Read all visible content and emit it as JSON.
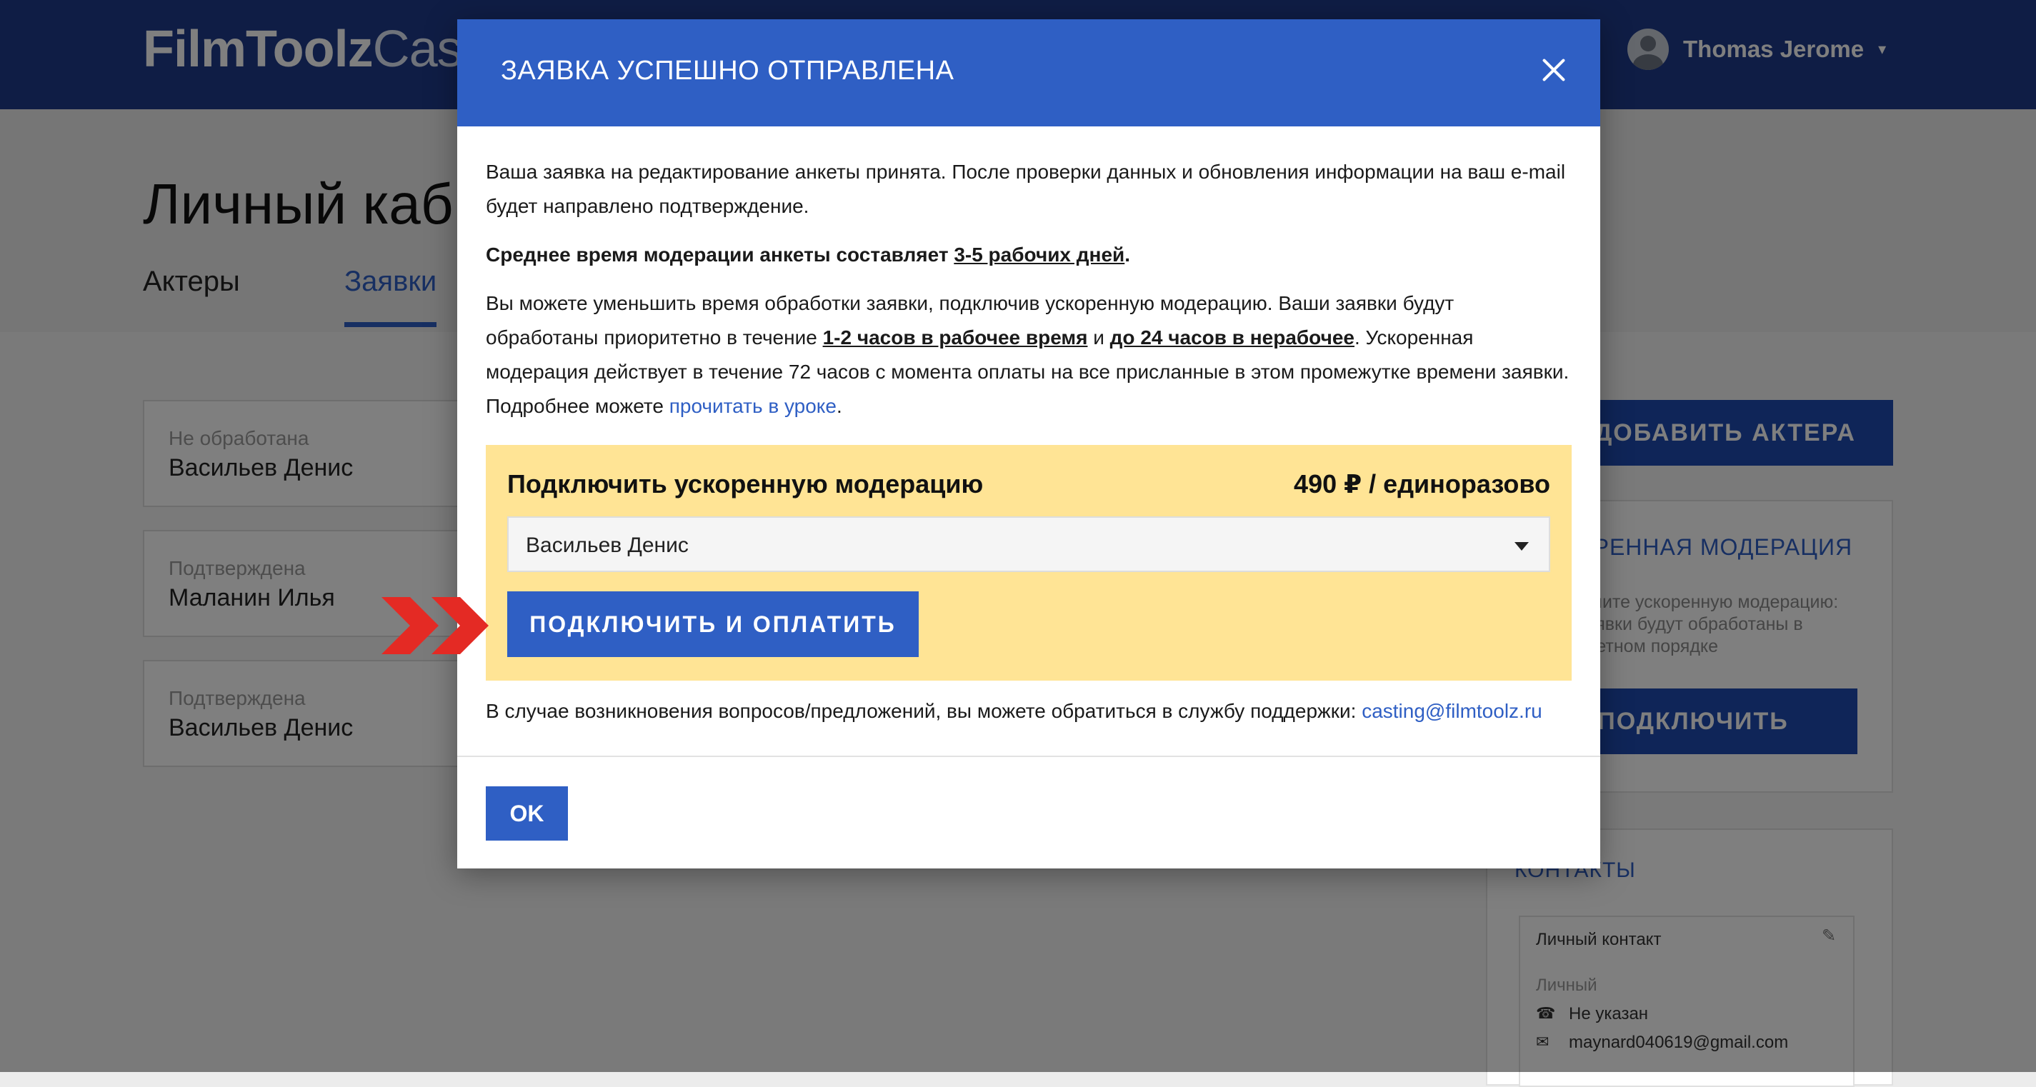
{
  "app": {
    "logo_bold": "FilmToolz",
    "logo_light": "Casting",
    "user_name": "Thomas Jerome",
    "caret": "▾"
  },
  "page": {
    "title": "Личный кабинет",
    "tabs": [
      {
        "label": "Актеры"
      },
      {
        "label": "Заявки"
      }
    ]
  },
  "requests": [
    {
      "status": "Не обработана",
      "name": "Васильев Денис"
    },
    {
      "status": "Подтверждена",
      "name": "Маланин Илья"
    },
    {
      "status": "Подтверждена",
      "name": "Васильев Денис"
    }
  ],
  "sidebar": {
    "add_actor_label": "ДОБАВИТЬ АКТЕРА",
    "fast_title": "УСКОРЕННАЯ МОДЕРАЦИЯ",
    "fast_text": "Подключите ускоренную модерацию: ваши заявки будут обработаны в приоритетном порядке",
    "connect_label": "ПОДКЛЮЧИТЬ",
    "contacts_title": "КОНТАКТЫ",
    "contact_label": "Личный контакт",
    "contact_sub": "Личный",
    "contact_phone": "Не указан",
    "contact_email": "maynard040619@gmail.com"
  },
  "modal": {
    "title": "ЗАЯВКА УСПЕШНО ОТПРАВЛЕНА",
    "intro": "Ваша заявка на редактирование анкеты принята. После проверки данных и обновления информации на ваш e-mail будет направлено подтверждение.",
    "moderation_prefix": "Среднее время модерации анкеты составляет ",
    "moderation_time": "3-5 рабочих дней",
    "moderation_suffix": ".",
    "fast_1": "Вы можете уменьшить время обработки заявки, подключив ускоренную модерацию. Ваши заявки будут обработаны приоритетно в течение ",
    "fast_work_time": "1-2 часов в рабочее время",
    "fast_2": " и ",
    "fast_off_time": "до 24 часов в нерабочее",
    "fast_3": ". Ускоренная модерация действует в течение 72 часов с момента оплаты на все присланные в этом промежутке времени заявки. Подробнее можете ",
    "fast_link": "прочитать в уроке",
    "fast_end": ".",
    "promo_title": "Подключить ускоренную модерацию",
    "promo_price": "490 ₽ / единоразово",
    "select_value": "Васильев Денис",
    "pay_label": "ПОДКЛЮЧИТЬ И ОПЛАТИТЬ",
    "support_text": "В случае возникновения вопросов/предложений, вы можете обратиться в службу поддержки: ",
    "support_email": "casting@filmtoolz.ru",
    "ok_label": "OK"
  },
  "colors": {
    "header_blue": "#1e3a8a",
    "modal_blue": "#2f5fc4",
    "promo_yellow": "#ffe495",
    "arrow_red": "#e42a24"
  }
}
